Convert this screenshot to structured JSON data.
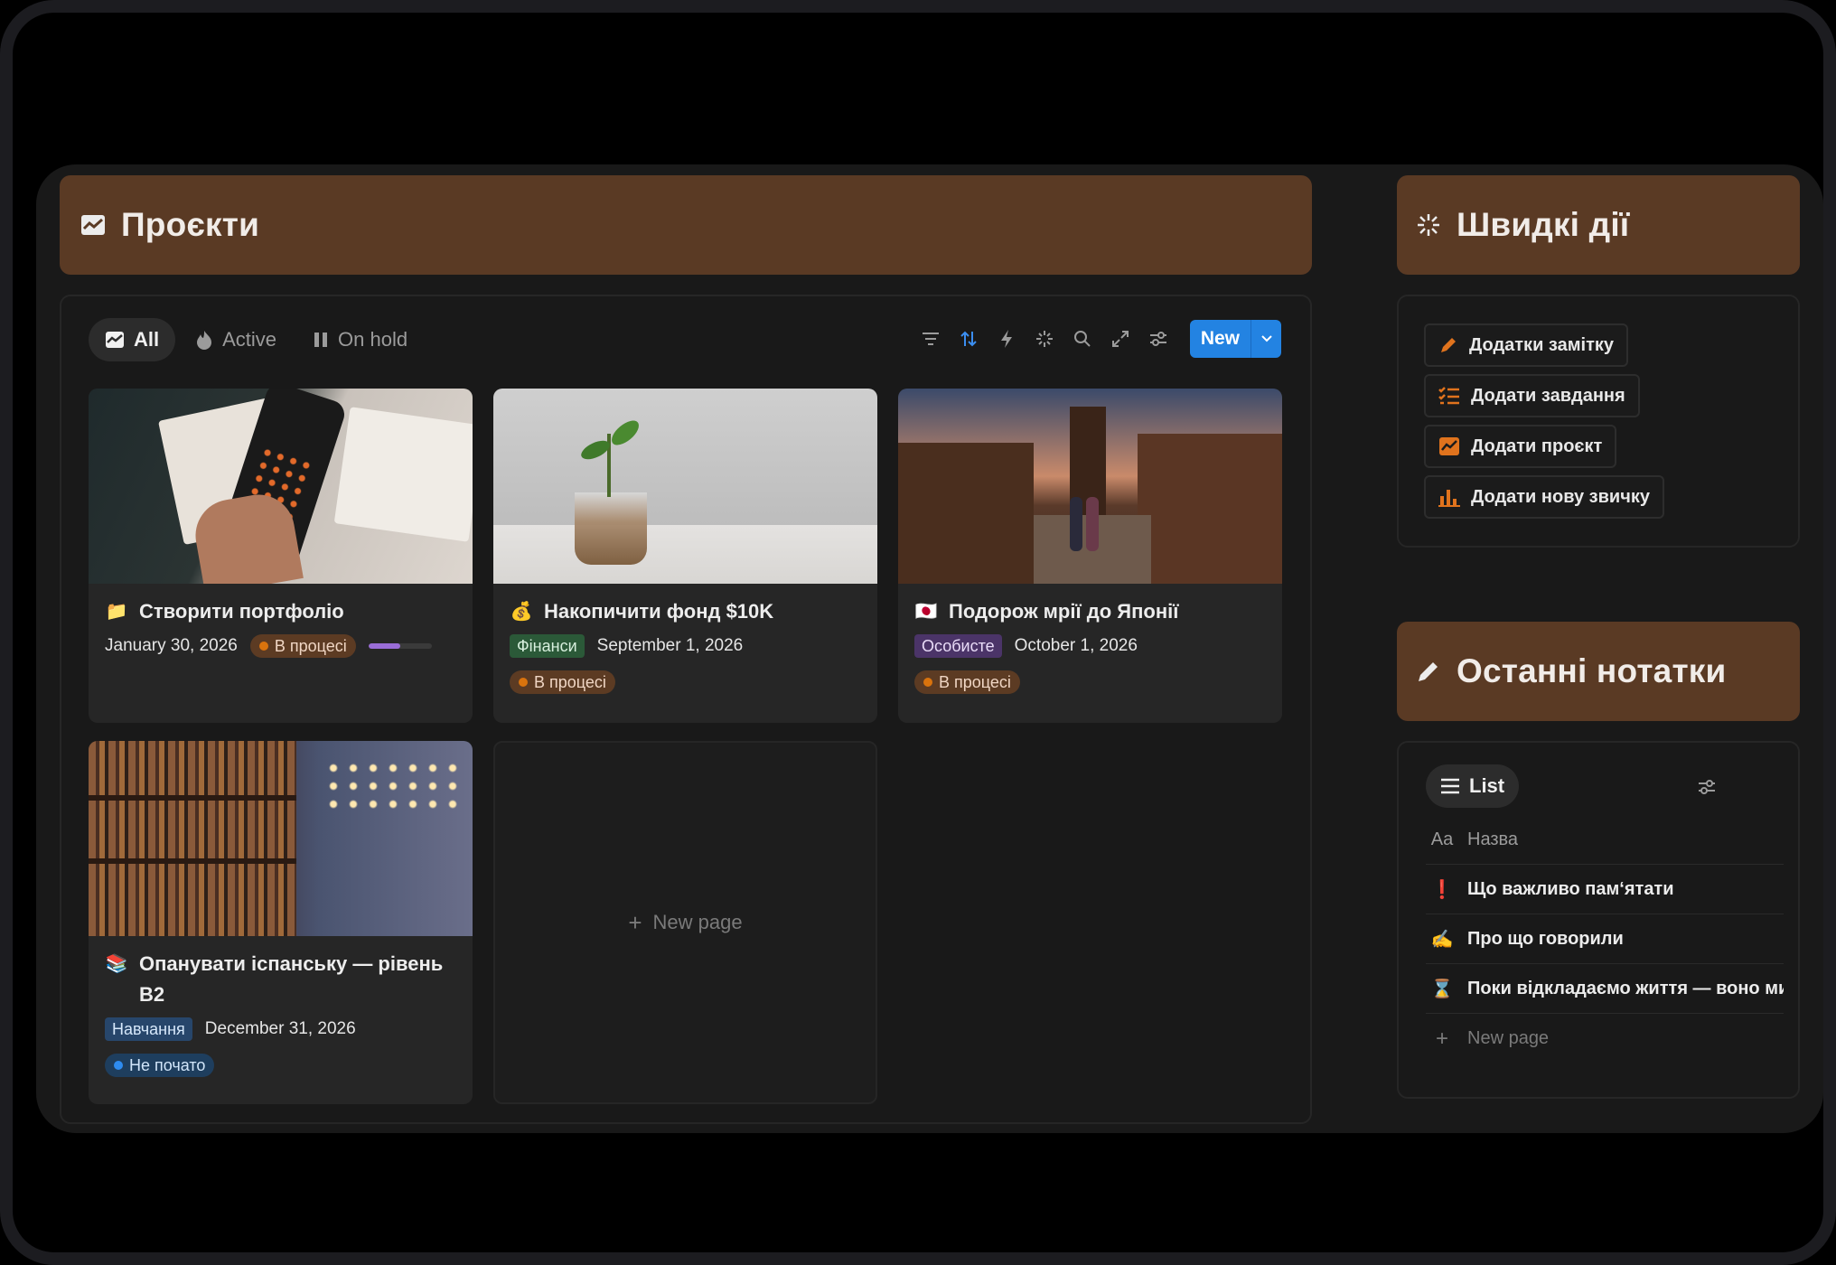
{
  "projects": {
    "title": "Проєкти",
    "tabs": [
      {
        "label": "All",
        "active": true,
        "icon": "chart-icon"
      },
      {
        "label": "Active",
        "active": false,
        "icon": "flame-icon"
      },
      {
        "label": "On hold",
        "active": false,
        "icon": "pause-icon"
      }
    ],
    "tools": [
      "filter-icon",
      "sort-icon",
      "automation-icon",
      "ai-sparkle-icon",
      "search-icon",
      "expand-icon",
      "settings-icon"
    ],
    "new_label": "New",
    "cards": [
      {
        "emoji": "📁",
        "title": "Створити портфоліо",
        "date": "January 30, 2026",
        "status": "В процесі",
        "progress": 0.5
      },
      {
        "emoji": "💰",
        "title": "Накопичити фонд $10K",
        "tag": "Фінанси",
        "date": "September 1, 2026",
        "status": "В процесі"
      },
      {
        "emoji": "🇯🇵",
        "title": "Подорож мрії до Японії",
        "tag": "Особисте",
        "date": "October 1, 2026",
        "status": "В процесі"
      },
      {
        "emoji": "📚",
        "title": "Опанувати іспанську — рівень B2",
        "tag": "Навчання",
        "date": "December 31, 2026",
        "status": "Не почато"
      }
    ],
    "new_page_label": "New page"
  },
  "quick_actions": {
    "title": "Швидкі дії",
    "items": [
      {
        "label": "Додатки замітку",
        "icon": "pencil-icon"
      },
      {
        "label": "Додати завдання",
        "icon": "checklist-icon"
      },
      {
        "label": "Додати проєкт",
        "icon": "chart-icon"
      },
      {
        "label": "Додати нову звичку",
        "icon": "bar-chart-icon"
      }
    ]
  },
  "notes": {
    "title": "Останні нотатки",
    "view_label": "List",
    "column_label": "Назва",
    "column_icon_text": "Aa",
    "rows": [
      {
        "emoji": "❗",
        "title": "Що важливо пам‘ятати"
      },
      {
        "emoji": "🫱",
        "title": "Про що говорили"
      },
      {
        "emoji": "⌛",
        "title": "Поки відкладаємо життя — воно мине"
      }
    ],
    "new_page_label": "New page"
  },
  "colors": {
    "banner": "#5a3a24",
    "accent_blue": "#2383e2",
    "background": "#191919"
  }
}
